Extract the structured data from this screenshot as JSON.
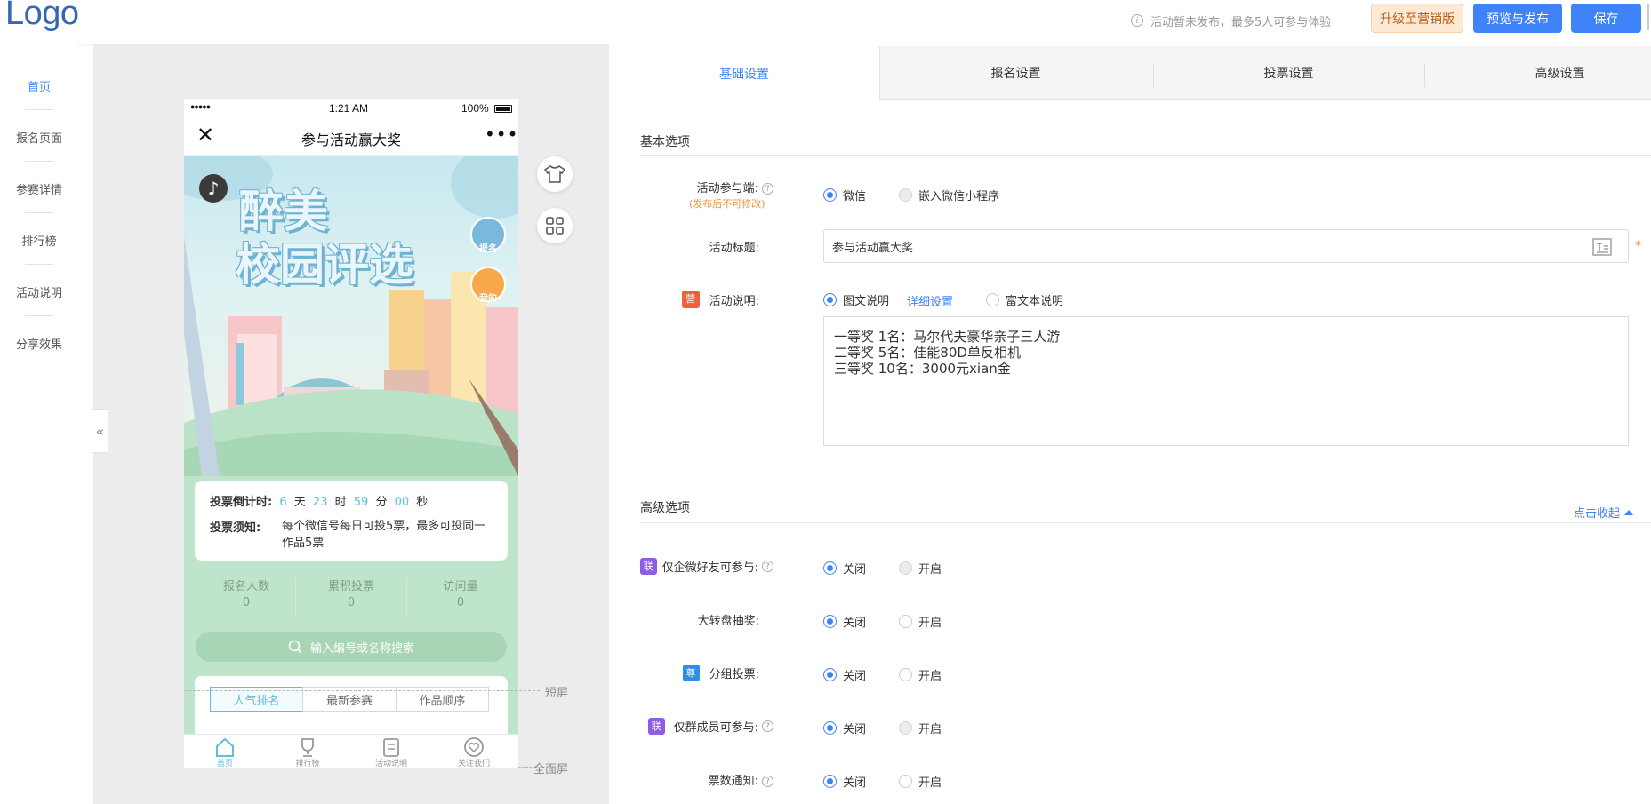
{
  "topbar": {
    "logo": "Logo",
    "notice": "活动暂未发布，最多5人可参与体验",
    "upgrade_label": "升级至营销版",
    "preview_label": "预览与发布",
    "save_label": "保存"
  },
  "leftnav": {
    "items": [
      {
        "label": "首页"
      },
      {
        "label": "报名页面"
      },
      {
        "label": "参赛详情"
      },
      {
        "label": "排行榜"
      },
      {
        "label": "活动说明"
      },
      {
        "label": "分享效果"
      }
    ]
  },
  "phone": {
    "status": {
      "signal": "●●●●●",
      "time": "1:21 AM",
      "battery": "100%"
    },
    "title": "参与活动赢大奖",
    "banner": {
      "title_line1": "醉美",
      "title_line2": "校园评选",
      "signup_label": "报名",
      "mine_label": "我的"
    },
    "countdown": {
      "label": "投票倒计时:",
      "days": "6",
      "days_unit": "天",
      "hours": "23",
      "hours_unit": "时",
      "minutes": "59",
      "minutes_unit": "分",
      "seconds": "00",
      "seconds_unit": "秒"
    },
    "rules": {
      "label": "投票须知:",
      "text": "每个微信号每日可投5票，最多可投同一作品5票"
    },
    "stats": [
      {
        "label": "报名人数",
        "value": "0"
      },
      {
        "label": "累积投票",
        "value": "0"
      },
      {
        "label": "访问量",
        "value": "0"
      }
    ],
    "search_placeholder": "输入编号或名称搜索",
    "rank_tabs": [
      {
        "label": "人气排名"
      },
      {
        "label": "最新参赛"
      },
      {
        "label": "作品顺序"
      }
    ],
    "tabbar": [
      {
        "label": "首页"
      },
      {
        "label": "排行榜"
      },
      {
        "label": "活动说明"
      },
      {
        "label": "关注我们"
      }
    ]
  },
  "preview_markers": {
    "short": "短屏",
    "full": "全面屏"
  },
  "accent_color": "#3f83f8",
  "settings": {
    "tabs": [
      {
        "label": "基础设置"
      },
      {
        "label": "报名设置"
      },
      {
        "label": "投票设置"
      },
      {
        "label": "高级设置"
      }
    ],
    "basic": {
      "title": "基本选项",
      "participant_label": "活动参与端:",
      "participant_note": "(发布后不可修改)",
      "participant_options": [
        "微信",
        "嵌入微信小程序"
      ],
      "title_label": "活动标题:",
      "title_value": "参与活动赢大奖",
      "desc_label": "活动说明:",
      "desc_badge": "营",
      "desc_option_graphic": "图文说明",
      "desc_detail_link": "详细设置",
      "desc_option_rich": "富文本说明",
      "desc_text": "一等奖 1名：马尔代夫豪华亲子三人游\n二等奖 5名：佳能80D单反相机\n三等奖 10名：3000元xian金"
    },
    "advanced": {
      "title": "高级选项",
      "collapse_label": "点击收起",
      "rows": [
        {
          "badge": "联",
          "label": "仅企微好友可参与:",
          "off": "关闭",
          "on": "开启"
        },
        {
          "badge": "",
          "label": "大转盘抽奖:",
          "off": "关闭",
          "on": "开启"
        },
        {
          "badge": "尊",
          "label": "分组投票:",
          "off": "关闭",
          "on": "开启"
        },
        {
          "badge": "联",
          "label": "仅群成员可参与:",
          "off": "关闭",
          "on": "开启"
        },
        {
          "badge": "",
          "label": "票数通知:",
          "off": "关闭",
          "on": "开启"
        }
      ]
    }
  }
}
